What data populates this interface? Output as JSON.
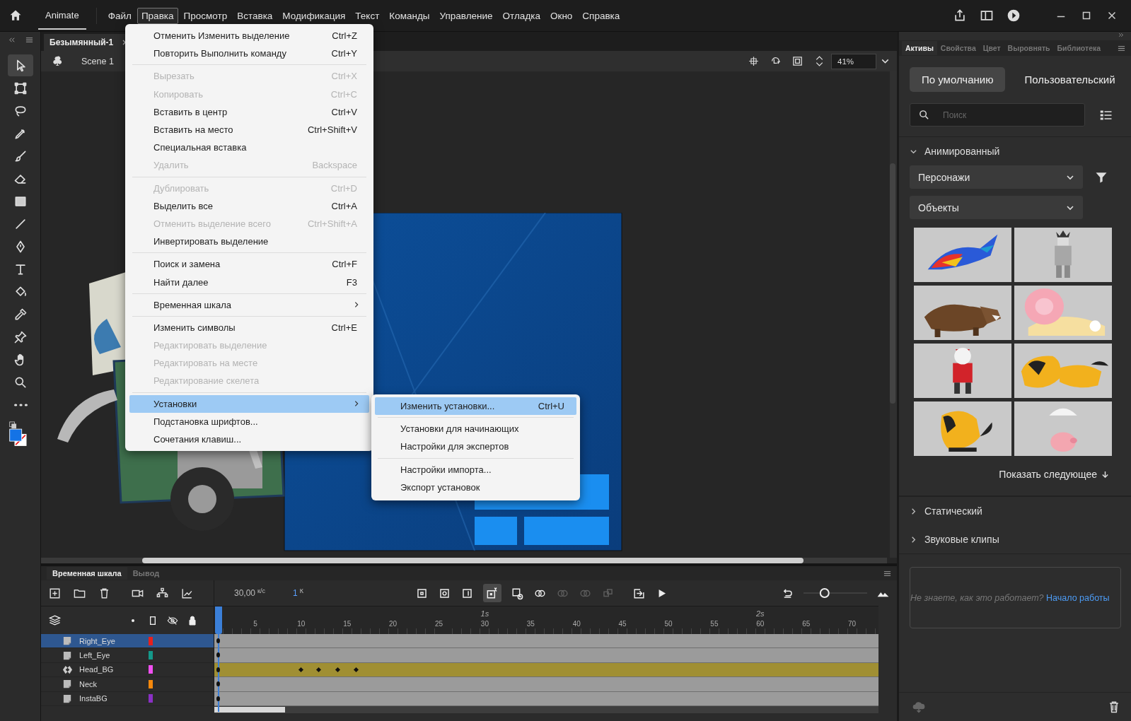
{
  "app_name": "Animate",
  "menu_bar": [
    {
      "label": "Файл",
      "selected": false
    },
    {
      "label": "Правка",
      "selected": true
    },
    {
      "label": "Просмотр",
      "selected": false
    },
    {
      "label": "Вставка",
      "selected": false
    },
    {
      "label": "Модификация",
      "selected": false
    },
    {
      "label": "Текст",
      "selected": false
    },
    {
      "label": "Команды",
      "selected": false
    },
    {
      "label": "Управление",
      "selected": false
    },
    {
      "label": "Отладка",
      "selected": false
    },
    {
      "label": "Окно",
      "selected": false
    },
    {
      "label": "Справка",
      "selected": false
    }
  ],
  "tools": [
    {
      "kind": "select",
      "selected": true
    },
    {
      "kind": "transform",
      "selected": false
    },
    {
      "kind": "lasso",
      "selected": false
    },
    {
      "kind": "pencil",
      "selected": false
    },
    {
      "kind": "brush",
      "selected": false
    },
    {
      "kind": "eraser",
      "selected": false
    },
    {
      "kind": "rectangle",
      "selected": false
    },
    {
      "kind": "line",
      "selected": false
    },
    {
      "kind": "pen",
      "selected": false
    },
    {
      "kind": "text",
      "selected": false
    },
    {
      "kind": "bucket",
      "selected": false
    },
    {
      "kind": "eyedropper",
      "selected": false
    },
    {
      "kind": "pin",
      "selected": false
    },
    {
      "kind": "hand",
      "selected": false
    },
    {
      "kind": "zoom",
      "selected": false
    },
    {
      "kind": "more",
      "selected": false
    }
  ],
  "document_tab": {
    "title": "Безымянный-1"
  },
  "scene": {
    "name": "Scene 1"
  },
  "zoom_field": {
    "value": "41%"
  },
  "edit_menu": [
    {
      "kind": "item",
      "label": "Отменить Изменить выделение",
      "shortcut": "Ctrl+Z",
      "disabled": false,
      "selected": false
    },
    {
      "kind": "item",
      "label": "Повторить Выполнить команду",
      "shortcut": "Ctrl+Y",
      "disabled": false,
      "selected": false
    },
    {
      "kind": "separator"
    },
    {
      "kind": "item",
      "label": "Вырезать",
      "shortcut": "Ctrl+X",
      "disabled": true,
      "selected": false
    },
    {
      "kind": "item",
      "label": "Копировать",
      "shortcut": "Ctrl+C",
      "disabled": true,
      "selected": false
    },
    {
      "kind": "item",
      "label": "Вставить в центр",
      "shortcut": "Ctrl+V",
      "disabled": false,
      "selected": false
    },
    {
      "kind": "item",
      "label": "Вставить на место",
      "shortcut": "Ctrl+Shift+V",
      "disabled": false,
      "selected": false
    },
    {
      "kind": "item",
      "label": "Специальная вставка",
      "disabled": false,
      "selected": false
    },
    {
      "kind": "item",
      "label": "Удалить",
      "shortcut": "Backspace",
      "disabled": true,
      "selected": false
    },
    {
      "kind": "separator"
    },
    {
      "kind": "item",
      "label": "Дублировать",
      "shortcut": "Ctrl+D",
      "disabled": true,
      "selected": false
    },
    {
      "kind": "item",
      "label": "Выделить все",
      "shortcut": "Ctrl+A",
      "disabled": false,
      "selected": false
    },
    {
      "kind": "item",
      "label": "Отменить выделение всего",
      "shortcut": "Ctrl+Shift+A",
      "disabled": true,
      "selected": false
    },
    {
      "kind": "item",
      "label": "Инвертировать выделение",
      "disabled": false,
      "selected": false
    },
    {
      "kind": "separator"
    },
    {
      "kind": "item",
      "label": "Поиск и замена",
      "shortcut": "Ctrl+F",
      "disabled": false,
      "selected": false
    },
    {
      "kind": "item",
      "label": "Найти далее",
      "shortcut": "F3",
      "disabled": false,
      "selected": false
    },
    {
      "kind": "separator"
    },
    {
      "kind": "submenu",
      "label": "Временная шкала",
      "disabled": false,
      "selected": false
    },
    {
      "kind": "separator"
    },
    {
      "kind": "item",
      "label": "Изменить символы",
      "shortcut": "Ctrl+E",
      "disabled": false,
      "selected": false
    },
    {
      "kind": "item",
      "label": "Редактировать выделение",
      "disabled": true,
      "selected": false
    },
    {
      "kind": "item",
      "label": "Редактировать на месте",
      "disabled": true,
      "selected": false
    },
    {
      "kind": "item",
      "label": "Редактирование скелета",
      "disabled": true,
      "selected": false
    },
    {
      "kind": "separator"
    },
    {
      "kind": "submenu",
      "label": "Установки",
      "disabled": false,
      "selected": true
    },
    {
      "kind": "item",
      "label": "Подстановка шрифтов...",
      "disabled": false,
      "selected": false
    },
    {
      "kind": "item",
      "label": "Сочетания клавиш...",
      "disabled": false,
      "selected": false
    }
  ],
  "preferences_submenu": [
    {
      "kind": "item",
      "label": "Изменить установки...",
      "shortcut": "Ctrl+U",
      "disabled": false,
      "selected": true
    },
    {
      "kind": "separator"
    },
    {
      "kind": "item",
      "label": "Установки для начинающих",
      "disabled": false,
      "selected": false
    },
    {
      "kind": "item",
      "label": "Настройки для экспертов",
      "disabled": false,
      "selected": false
    },
    {
      "kind": "separator"
    },
    {
      "kind": "item",
      "label": "Настройки импорта...",
      "disabled": false,
      "selected": false
    },
    {
      "kind": "item",
      "label": "Экспорт установок",
      "disabled": false,
      "selected": false
    }
  ],
  "timeline": {
    "tabs": [
      {
        "label": "Временная шкала",
        "selected": true
      },
      {
        "label": "Вывод",
        "selected": false
      }
    ],
    "fps": "30,00",
    "fps_unit": "к/с",
    "frame": "1",
    "frame_unit": "К",
    "seconds": [
      "1s",
      "2s"
    ],
    "zoom_slider": {
      "level": 0.3
    },
    "frame_numbers": [
      "5",
      "10",
      "15",
      "20",
      "25",
      "30",
      "35",
      "40",
      "45",
      "50",
      "55",
      "60",
      "65",
      "70"
    ],
    "layers": [
      {
        "name": "Right_Eye",
        "kind": "layer",
        "color": "#e8201c",
        "selected": true,
        "tween": false
      },
      {
        "name": "Left_Eye",
        "kind": "layer",
        "color": "#14998a",
        "selected": false,
        "tween": false
      },
      {
        "name": "Head_BG",
        "kind": "symbol",
        "color": "#f04ff0",
        "selected": false,
        "tween": true,
        "keyframes": [
          {
            "level": 0.131
          },
          {
            "level": 0.158
          },
          {
            "level": 0.186
          },
          {
            "level": 0.214
          }
        ]
      },
      {
        "name": "Neck",
        "kind": "layer",
        "color": "#f5880c",
        "selected": false,
        "tween": false
      },
      {
        "name": "InstaBG",
        "kind": "layer",
        "color": "#8a30c4",
        "selected": false,
        "tween": false
      }
    ]
  },
  "assets_panel": {
    "tabs": [
      {
        "label": "Активы",
        "selected": true
      },
      {
        "label": "Свойства",
        "selected": false
      },
      {
        "label": "Цвет",
        "selected": false
      },
      {
        "label": "Выровнять",
        "selected": false
      },
      {
        "label": "Библиотека",
        "selected": false
      }
    ],
    "segments": [
      {
        "label": "По умолчанию",
        "selected": true
      },
      {
        "label": "Пользовательский",
        "selected": false
      }
    ],
    "search": {
      "placeholder": "Поиск"
    },
    "sections": [
      {
        "label": "Анимированный",
        "expanded": true
      },
      {
        "label": "Статический",
        "expanded": false
      },
      {
        "label": "Звуковые клипы",
        "expanded": false
      }
    ],
    "dropdowns": [
      {
        "value": "Персонажи"
      },
      {
        "value": "Объекты"
      }
    ],
    "show_more": "Показать следующее",
    "help": {
      "text": "Не знаете, как это работает?",
      "link": "Начало работы"
    }
  }
}
